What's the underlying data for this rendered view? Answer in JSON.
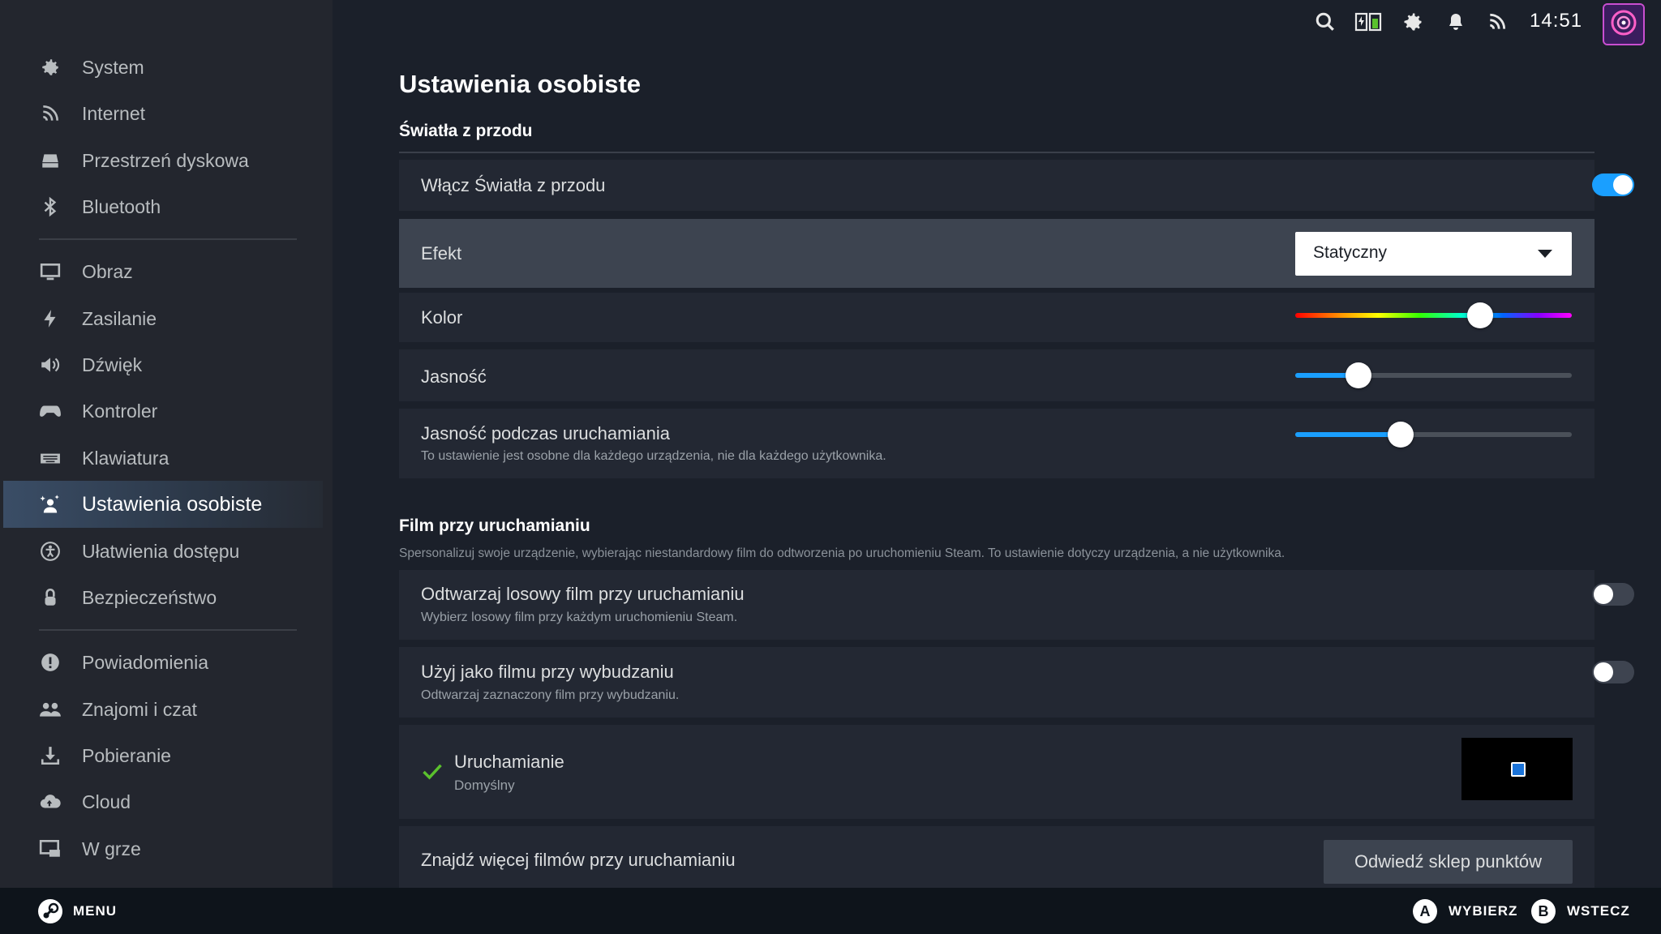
{
  "sidebar": {
    "items": [
      {
        "label": "System",
        "icon": "gear-icon"
      },
      {
        "label": "Internet",
        "icon": "wifi-icon"
      },
      {
        "label": "Przestrzeń dyskowa",
        "icon": "storage-icon"
      },
      {
        "label": "Bluetooth",
        "icon": "bluetooth-icon"
      },
      {
        "label": "Obraz",
        "icon": "display-icon"
      },
      {
        "label": "Zasilanie",
        "icon": "bolt-icon"
      },
      {
        "label": "Dźwięk",
        "icon": "speaker-icon"
      },
      {
        "label": "Kontroler",
        "icon": "gamepad-icon"
      },
      {
        "label": "Klawiatura",
        "icon": "keyboard-icon"
      },
      {
        "label": "Ustawienia osobiste",
        "icon": "person-sparkle-icon",
        "active": true
      },
      {
        "label": "Ułatwienia dostępu",
        "icon": "accessibility-icon"
      },
      {
        "label": "Bezpieczeństwo",
        "icon": "lock-icon"
      },
      {
        "label": "Powiadomienia",
        "icon": "alert-icon"
      },
      {
        "label": "Znajomi i czat",
        "icon": "friends-icon"
      },
      {
        "label": "Pobieranie",
        "icon": "download-icon"
      },
      {
        "label": "Cloud",
        "icon": "cloud-icon"
      },
      {
        "label": "W grze",
        "icon": "ingame-icon"
      }
    ]
  },
  "topbar": {
    "time": "14:51",
    "icons": [
      "search-icon",
      "battery-icon",
      "gear-icon",
      "bell-icon",
      "wifi-icon",
      "avatar"
    ]
  },
  "main": {
    "title": "Ustawienia osobiste",
    "front_lights": {
      "section_title": "Światła z przodu",
      "enable_label": "Włącz Światła z przodu",
      "enable_on": true,
      "effect_label": "Efekt",
      "effect_value": "Statyczny",
      "color_label": "Kolor",
      "color_level": 0.67,
      "brightness_label": "Jasność",
      "brightness_level": 0.23,
      "boot_brightness_label": "Jasność podczas uruchamiania",
      "boot_brightness_sub": "To ustawienie jest osobne dla każdego urządzenia, nie dla każdego użytkownika.",
      "boot_brightness_level": 0.38
    },
    "startup_movie": {
      "section_title": "Film przy uruchamianiu",
      "section_desc": "Spersonalizuj swoje urządzenie, wybierając niestandardowy film do odtworzenia po uruchomieniu Steam. To ustawienie dotyczy urządzenia, a nie użytkownika.",
      "random_label": "Odtwarzaj losowy film przy uruchamianiu",
      "random_sub": "Wybierz losowy film przy każdym uruchomieniu Steam.",
      "random_on": false,
      "wake_label": "Użyj jako filmu przy wybudzaniu",
      "wake_sub": "Odtwarzaj zaznaczony film przy wybudzaniu.",
      "wake_on": false,
      "selected_title": "Uruchamianie",
      "selected_sub": "Domyślny",
      "find_more_label": "Znajdź więcej filmów przy uruchamianiu",
      "visit_button": "Odwiedź sklep punktów"
    }
  },
  "footer": {
    "menu": "MENU",
    "a_glyph": "A",
    "a_label": "WYBIERZ",
    "b_glyph": "B",
    "b_label": "WSTECZ"
  },
  "colors": {
    "accent": "#1a9fff",
    "background": "#1b202a",
    "sidebar": "#23262e",
    "check": "#5ac12d"
  }
}
